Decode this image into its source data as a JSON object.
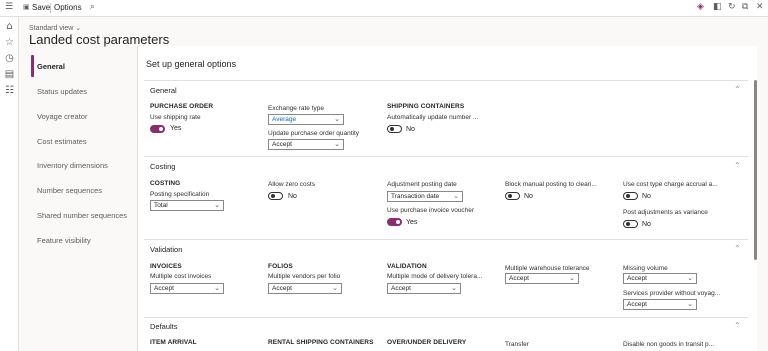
{
  "toolbar": {
    "save": "Save",
    "options": "Options"
  },
  "view": {
    "name": "Standard view",
    "title": "Landed cost parameters"
  },
  "tabs": [
    "General",
    "Status updates",
    "Voyage creator",
    "Cost estimates",
    "Inventory dimensions",
    "Number sequences",
    "Shared number sequences",
    "Feature visibility"
  ],
  "page_heading": "Set up general options",
  "general": {
    "title": "General",
    "purchase_order": "PURCHASE ORDER",
    "use_shipping_rate": "Use shipping rate",
    "use_shipping_rate_val": "Yes",
    "exchange_rate_type": "Exchange rate type",
    "exchange_rate_val": "Average",
    "update_po_qty": "Update purchase order quantity",
    "update_po_qty_val": "Accept",
    "shipping_containers": "SHIPPING CONTAINERS",
    "auto_update": "Automatically update number ...",
    "auto_update_val": "No"
  },
  "costing": {
    "title": "Costing",
    "group": "COSTING",
    "posting_spec": "Posting specification",
    "posting_spec_val": "Total",
    "allow_zero": "Allow zero costs",
    "allow_zero_val": "No",
    "adj_posting_date": "Adjustment posting date",
    "adj_posting_date_val": "Transaction date",
    "use_pi_voucher": "Use purchase invoice voucher",
    "use_pi_voucher_val": "Yes",
    "block_manual": "Block manual posting to cleari...",
    "block_manual_val": "No",
    "cost_type_accrual": "Use cost type charge accrual a...",
    "cost_type_accrual_val": "No",
    "post_adj_variance": "Post adjustments as variance",
    "post_adj_variance_val": "No"
  },
  "validation": {
    "title": "Validation",
    "invoices": "INVOICES",
    "multi_cost_inv": "Multiple cost invoices",
    "multi_cost_inv_val": "Accept",
    "folios": "FOLIOS",
    "multi_vendors": "Multiple vendors per folio",
    "multi_vendors_val": "Accept",
    "validation_grp": "VALIDATION",
    "multi_mode": "Multiple mode of delivery tolera...",
    "multi_mode_val": "Accept",
    "multi_wh": "Multiple warehouse tolerance",
    "multi_wh_val": "Accept",
    "missing_vol": "Missing volume",
    "missing_vol_val": "Accept",
    "services_provider": "Services provider without voyag...",
    "services_provider_val": "Accept"
  },
  "defaults": {
    "title": "Defaults",
    "item_arrival": "ITEM ARRIVAL",
    "rental": "RENTAL SHIPPING CONTAINERS",
    "over_under": "OVER/UNDER DELIVERY",
    "transfer": "Transfer",
    "disable_non_goods": "Disable non goods in transit p..."
  }
}
